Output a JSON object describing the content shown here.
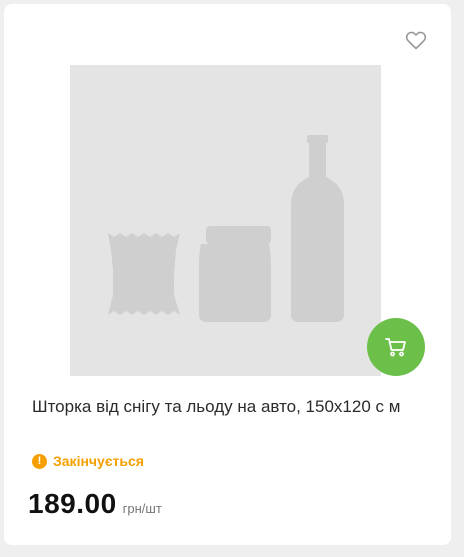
{
  "product": {
    "title": "Шторка від снігу та льоду на авто, 150х120 с м",
    "stock_status": "Закінчується",
    "price": "189.00",
    "unit": "грн/шт"
  },
  "icons": {
    "favorite": "heart-outline-icon",
    "cart": "cart-icon",
    "stock": "exclamation-icon",
    "placeholder": "product-placeholder-image"
  },
  "colors": {
    "accent_green": "#6cc04a",
    "warning_orange": "#f5a000",
    "placeholder_bg": "#e4e4e4",
    "placeholder_shapes": "#cfcfcf"
  }
}
